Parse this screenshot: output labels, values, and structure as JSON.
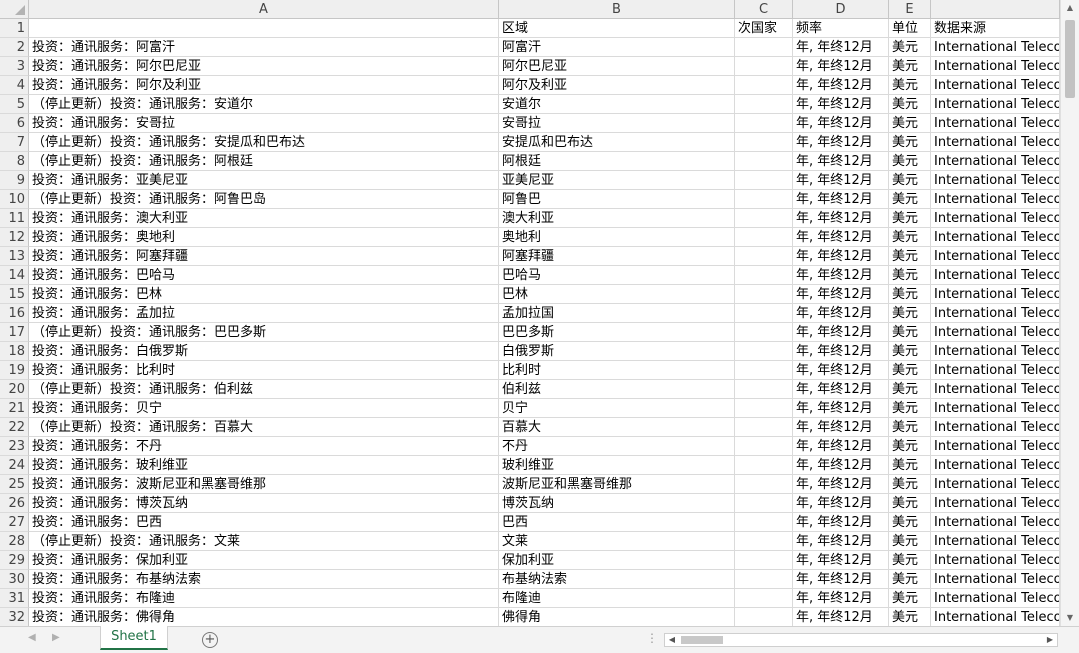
{
  "columns": [
    "A",
    "B",
    "C",
    "D",
    "E"
  ],
  "rows": [
    {
      "n": "1",
      "a": "",
      "b": "区域",
      "c": "次国家",
      "d": "频率",
      "e": "单位",
      "f": "数据来源"
    },
    {
      "n": "2",
      "a": "投资：通讯服务：阿富汗",
      "b": "阿富汗",
      "c": "",
      "d": "年, 年终12月",
      "e": "美元",
      "f": "International Teleco"
    },
    {
      "n": "3",
      "a": "投资：通讯服务：阿尔巴尼亚",
      "b": "阿尔巴尼亚",
      "c": "",
      "d": "年, 年终12月",
      "e": "美元",
      "f": "International Teleco"
    },
    {
      "n": "4",
      "a": "投资：通讯服务：阿尔及利亚",
      "b": "阿尔及利亚",
      "c": "",
      "d": "年, 年终12月",
      "e": "美元",
      "f": "International Teleco"
    },
    {
      "n": "5",
      "a": "（停止更新）投资：通讯服务：安道尔",
      "b": "安道尔",
      "c": "",
      "d": "年, 年终12月",
      "e": "美元",
      "f": "International Teleco"
    },
    {
      "n": "6",
      "a": "投资：通讯服务：安哥拉",
      "b": "安哥拉",
      "c": "",
      "d": "年, 年终12月",
      "e": "美元",
      "f": "International Teleco"
    },
    {
      "n": "7",
      "a": "（停止更新）投资：通讯服务：安提瓜和巴布达",
      "b": "安提瓜和巴布达",
      "c": "",
      "d": "年, 年终12月",
      "e": "美元",
      "f": "International Teleco"
    },
    {
      "n": "8",
      "a": "（停止更新）投资：通讯服务：阿根廷",
      "b": "阿根廷",
      "c": "",
      "d": "年, 年终12月",
      "e": "美元",
      "f": "International Teleco"
    },
    {
      "n": "9",
      "a": "投资：通讯服务：亚美尼亚",
      "b": "亚美尼亚",
      "c": "",
      "d": "年, 年终12月",
      "e": "美元",
      "f": "International Teleco"
    },
    {
      "n": "10",
      "a": "（停止更新）投资：通讯服务：阿鲁巴岛",
      "b": "阿鲁巴",
      "c": "",
      "d": "年, 年终12月",
      "e": "美元",
      "f": "International Teleco"
    },
    {
      "n": "11",
      "a": "投资：通讯服务：澳大利亚",
      "b": "澳大利亚",
      "c": "",
      "d": "年, 年终12月",
      "e": "美元",
      "f": "International Teleco"
    },
    {
      "n": "12",
      "a": "投资：通讯服务：奥地利",
      "b": "奥地利",
      "c": "",
      "d": "年, 年终12月",
      "e": "美元",
      "f": "International Teleco"
    },
    {
      "n": "13",
      "a": "投资：通讯服务：阿塞拜疆",
      "b": "阿塞拜疆",
      "c": "",
      "d": "年, 年终12月",
      "e": "美元",
      "f": "International Teleco"
    },
    {
      "n": "14",
      "a": "投资：通讯服务：巴哈马",
      "b": "巴哈马",
      "c": "",
      "d": "年, 年终12月",
      "e": "美元",
      "f": "International Teleco"
    },
    {
      "n": "15",
      "a": "投资：通讯服务：巴林",
      "b": "巴林",
      "c": "",
      "d": "年, 年终12月",
      "e": "美元",
      "f": "International Teleco"
    },
    {
      "n": "16",
      "a": "投资：通讯服务：孟加拉",
      "b": "孟加拉国",
      "c": "",
      "d": "年, 年终12月",
      "e": "美元",
      "f": "International Teleco"
    },
    {
      "n": "17",
      "a": "（停止更新）投资：通讯服务：巴巴多斯",
      "b": "巴巴多斯",
      "c": "",
      "d": "年, 年终12月",
      "e": "美元",
      "f": "International Teleco"
    },
    {
      "n": "18",
      "a": "投资：通讯服务：白俄罗斯",
      "b": "白俄罗斯",
      "c": "",
      "d": "年, 年终12月",
      "e": "美元",
      "f": "International Teleco"
    },
    {
      "n": "19",
      "a": "投资：通讯服务：比利时",
      "b": "比利时",
      "c": "",
      "d": "年, 年终12月",
      "e": "美元",
      "f": "International Teleco"
    },
    {
      "n": "20",
      "a": "（停止更新）投资：通讯服务：伯利兹",
      "b": "伯利兹",
      "c": "",
      "d": "年, 年终12月",
      "e": "美元",
      "f": "International Teleco"
    },
    {
      "n": "21",
      "a": "投资：通讯服务：贝宁",
      "b": "贝宁",
      "c": "",
      "d": "年, 年终12月",
      "e": "美元",
      "f": "International Teleco"
    },
    {
      "n": "22",
      "a": "（停止更新）投资：通讯服务：百慕大",
      "b": "百慕大",
      "c": "",
      "d": "年, 年终12月",
      "e": "美元",
      "f": "International Teleco"
    },
    {
      "n": "23",
      "a": "投资：通讯服务：不丹",
      "b": "不丹",
      "c": "",
      "d": "年, 年终12月",
      "e": "美元",
      "f": "International Teleco"
    },
    {
      "n": "24",
      "a": "投资：通讯服务：玻利维亚",
      "b": "玻利维亚",
      "c": "",
      "d": "年, 年终12月",
      "e": "美元",
      "f": "International Teleco"
    },
    {
      "n": "25",
      "a": "投资：通讯服务：波斯尼亚和黑塞哥维那",
      "b": "波斯尼亚和黑塞哥维那",
      "c": "",
      "d": "年, 年终12月",
      "e": "美元",
      "f": "International Teleco"
    },
    {
      "n": "26",
      "a": "投资：通讯服务：博茨瓦纳",
      "b": "博茨瓦纳",
      "c": "",
      "d": "年, 年终12月",
      "e": "美元",
      "f": "International Teleco"
    },
    {
      "n": "27",
      "a": "投资：通讯服务：巴西",
      "b": "巴西",
      "c": "",
      "d": "年, 年终12月",
      "e": "美元",
      "f": "International Teleco"
    },
    {
      "n": "28",
      "a": "（停止更新）投资：通讯服务：文莱",
      "b": "文莱",
      "c": "",
      "d": "年, 年终12月",
      "e": "美元",
      "f": "International Teleco"
    },
    {
      "n": "29",
      "a": "投资：通讯服务：保加利亚",
      "b": "保加利亚",
      "c": "",
      "d": "年, 年终12月",
      "e": "美元",
      "f": "International Teleco"
    },
    {
      "n": "30",
      "a": "投资：通讯服务：布基纳法索",
      "b": "布基纳法索",
      "c": "",
      "d": "年, 年终12月",
      "e": "美元",
      "f": "International Teleco"
    },
    {
      "n": "31",
      "a": "投资：通讯服务：布隆迪",
      "b": "布隆迪",
      "c": "",
      "d": "年, 年终12月",
      "e": "美元",
      "f": "International Teleco"
    },
    {
      "n": "32",
      "a": "投资：通讯服务：佛得角",
      "b": "佛得角",
      "c": "",
      "d": "年, 年终12月",
      "e": "美元",
      "f": "International Teleco"
    }
  ],
  "sheet_tab": "Sheet1",
  "add_sheet_symbol": "+",
  "scroll_dots": "⋮"
}
